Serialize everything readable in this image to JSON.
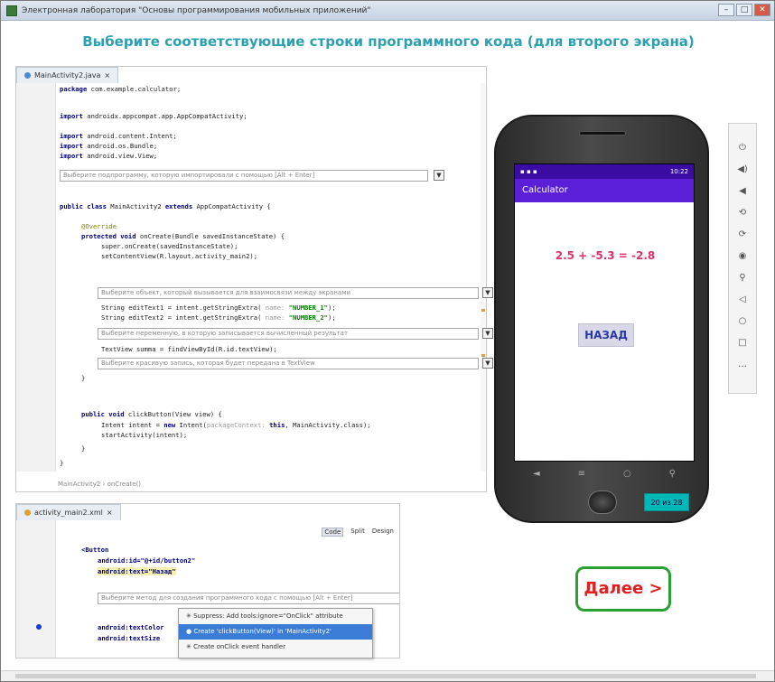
{
  "window": {
    "title": "Электронная лаборатория \"Основы программирования мобильных приложений\""
  },
  "heading": "Выберите соответствующие строки программного кода (для второго экрана)",
  "editor": {
    "tab_label": "MainActivity2.java",
    "lines": [
      {
        "kw": "package",
        "text": " com.example.calculator;"
      },
      {
        "kw": "import",
        "text": " androidx.appcompat.app.AppCompatActivity;"
      },
      {
        "kw": "import",
        "text": " android.content.Intent;"
      },
      {
        "kw": "import",
        "text": " android.os.Bundle;"
      },
      {
        "kw": "import",
        "text": " android.view.View;"
      }
    ],
    "dropdowns": [
      "Выберите подпрограмму, которую импортировали с помощью [Alt + Enter]",
      "Выберите объект, который вызывается для взаимосвязи между экранами",
      "Выберите переменную, в которую записывается вычисленный результат",
      "Выберите красивую запись, которая будет передана в TextView"
    ],
    "class_line": {
      "kw": "public class",
      "name": " MainActivity2 ",
      "kw2": "extends",
      "rest": " AppCompatActivity {"
    },
    "override": "@Override",
    "oncreate": {
      "kw": "protected void",
      "rest": " onCreate(Bundle savedInstanceState) {"
    },
    "super_line": "super.onCreate(savedInstanceState);",
    "setcontent": "setContentView(R.layout.activity_main2);",
    "string1": {
      "pre": "String editText1 = intent.getStringExtra(",
      "hint": " name: ",
      "str": "\"NUMBER_1\"",
      "post": ");"
    },
    "string2": {
      "pre": "String editText2 = intent.getStringExtra(",
      "hint": " name: ",
      "str": "\"NUMBER_2\"",
      "post": ");"
    },
    "textview_line": "TextView summa = findViewById(R.id.textView);",
    "close1": "}",
    "clickbutton": {
      "kw": "public void",
      "rest": " clickButton(View view) {"
    },
    "intent_line": {
      "pre": "Intent intent = ",
      "kw": "new",
      "mid": " Intent(",
      "hint": "packageContext: ",
      "kw2": "this",
      "post": ", MainActivity.class);"
    },
    "start_line": "startActivity(intent);",
    "close2": "}",
    "close3": "}",
    "breadcrumb": "MainActivity2 › onCreate()"
  },
  "phone": {
    "status_time": "10:22",
    "app_title": "Calculator",
    "result": "2.5 + -5.3 = -2.8",
    "back_button": "НАЗАД"
  },
  "timer": "20 из 28",
  "next_button": "Далее >",
  "xml_editor": {
    "tab_label": "activity_main2.xml",
    "view_code": "Code",
    "view_split": "Split",
    "view_design": "Design",
    "lines": [
      "<Button",
      "android:id=\"@+id/button2\"",
      "android:text=\"Назад\""
    ],
    "dropdown": "Выберите метод для создания программного кода с помощью [Alt + Enter]",
    "textcolor": "android:textColor",
    "textsize": "android:textSize"
  },
  "popup": [
    "Suppress: Add tools:ignore=\"OnClick\" attribute",
    "Create 'clickButton(View)' in 'MainActivity2'",
    "Create onClick event handler"
  ]
}
